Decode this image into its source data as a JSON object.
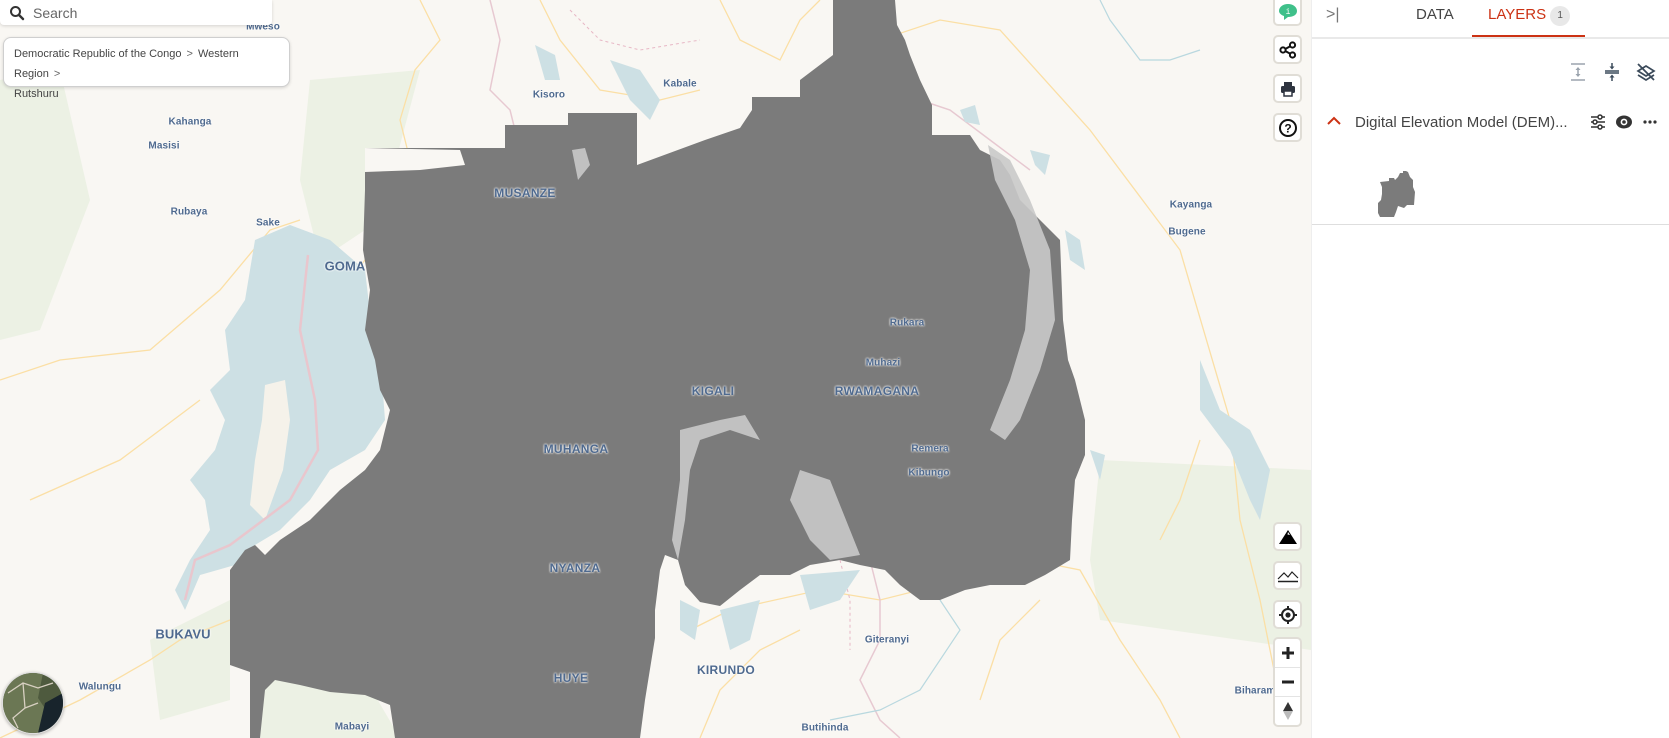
{
  "search": {
    "placeholder": "Search",
    "icon": "search-icon"
  },
  "breadcrumb": {
    "items": [
      "Democratic Republic of the Congo",
      "Western Region",
      "Rutshuru"
    ],
    "separator": ">"
  },
  "map": {
    "places": [
      {
        "name": "Mweso",
        "cls": ""
      },
      {
        "name": "Kahanga",
        "cls": ""
      },
      {
        "name": "Masisi",
        "cls": ""
      },
      {
        "name": "Rubaya",
        "cls": ""
      },
      {
        "name": "Sake",
        "cls": ""
      },
      {
        "name": "GOMA",
        "cls": "major"
      },
      {
        "name": "Kisoro",
        "cls": ""
      },
      {
        "name": "Kabale",
        "cls": ""
      },
      {
        "name": "MUSANZE",
        "cls": "city"
      },
      {
        "name": "KIGALI",
        "cls": "city"
      },
      {
        "name": "RWAMAGANA",
        "cls": "city"
      },
      {
        "name": "Rukara",
        "cls": ""
      },
      {
        "name": "Muhazi",
        "cls": ""
      },
      {
        "name": "MUHANGA",
        "cls": "city"
      },
      {
        "name": "Remera",
        "cls": ""
      },
      {
        "name": "Kibungo",
        "cls": ""
      },
      {
        "name": "NYANZA",
        "cls": "city"
      },
      {
        "name": "HUYE",
        "cls": "city"
      },
      {
        "name": "KIRUNDO",
        "cls": "city"
      },
      {
        "name": "Giteranyi",
        "cls": ""
      },
      {
        "name": "Butihinda",
        "cls": ""
      },
      {
        "name": "Mabayi",
        "cls": ""
      },
      {
        "name": "BUKAVU",
        "cls": "major"
      },
      {
        "name": "Walungu",
        "cls": ""
      },
      {
        "name": "Kayanga",
        "cls": ""
      },
      {
        "name": "Bugene",
        "cls": ""
      },
      {
        "name": "Biharam",
        "cls": ""
      }
    ],
    "controls": {
      "feedback": "chat-info-icon",
      "share": "share-icon",
      "print": "print-icon",
      "help": "help-icon",
      "terrain": "mountain-icon",
      "elevation": "elevation-profile-icon",
      "locate": "locate-icon",
      "zoom_in": "plus-icon",
      "zoom_out": "minus-icon",
      "compass": "compass-icon"
    },
    "colors": {
      "raster": "#7b7b7b",
      "water": "#cde0e4",
      "land": "#f9f7f3"
    }
  },
  "panel": {
    "collapse_label": ">|",
    "tabs": [
      {
        "label": "DATA",
        "active": false
      },
      {
        "label": "LAYERS",
        "active": true,
        "badge": "1"
      }
    ],
    "toolbar": [
      "expand-all-icon",
      "collapse-all-icon",
      "hide-all-layers-icon"
    ],
    "layers": [
      {
        "title": "Digital Elevation Model (DEM)...",
        "expanded": true,
        "actions": [
          "settings-sliders-icon",
          "visibility-eye-icon",
          "more-options-icon"
        ]
      }
    ],
    "accent_color": "#cc3214"
  }
}
